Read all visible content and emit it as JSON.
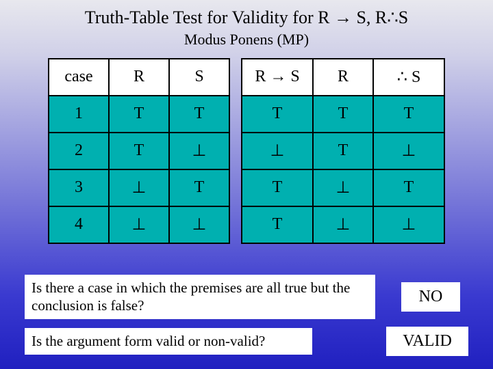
{
  "title": "Truth-Table Test for Validity for R → S, R∴S",
  "subtitle": "Modus Ponens (MP)",
  "headers": {
    "case": "case",
    "R": "R",
    "S": "S",
    "RimpS": "R → S",
    "R2": "R",
    "thereS": "∴ S"
  },
  "chart_data": {
    "type": "table",
    "title": "Truth-Table Test for Validity for R → S, R ∴ S (Modus Ponens)",
    "columns": [
      "case",
      "R",
      "S",
      "R → S",
      "R",
      "∴ S"
    ],
    "rows": [
      [
        "1",
        "T",
        "T",
        "T",
        "T",
        "T"
      ],
      [
        "2",
        "T",
        "⊥",
        "⊥",
        "T",
        "⊥"
      ],
      [
        "3",
        "⊥",
        "T",
        "T",
        "⊥",
        "T"
      ],
      [
        "4",
        "⊥",
        "⊥",
        "T",
        "⊥",
        "⊥"
      ]
    ]
  },
  "question1": "Is there a case in which the premises are all true but the conclusion is false?",
  "answer1": "NO",
  "question2": "Is the argument form valid or non-valid?",
  "answer2": "VALID"
}
